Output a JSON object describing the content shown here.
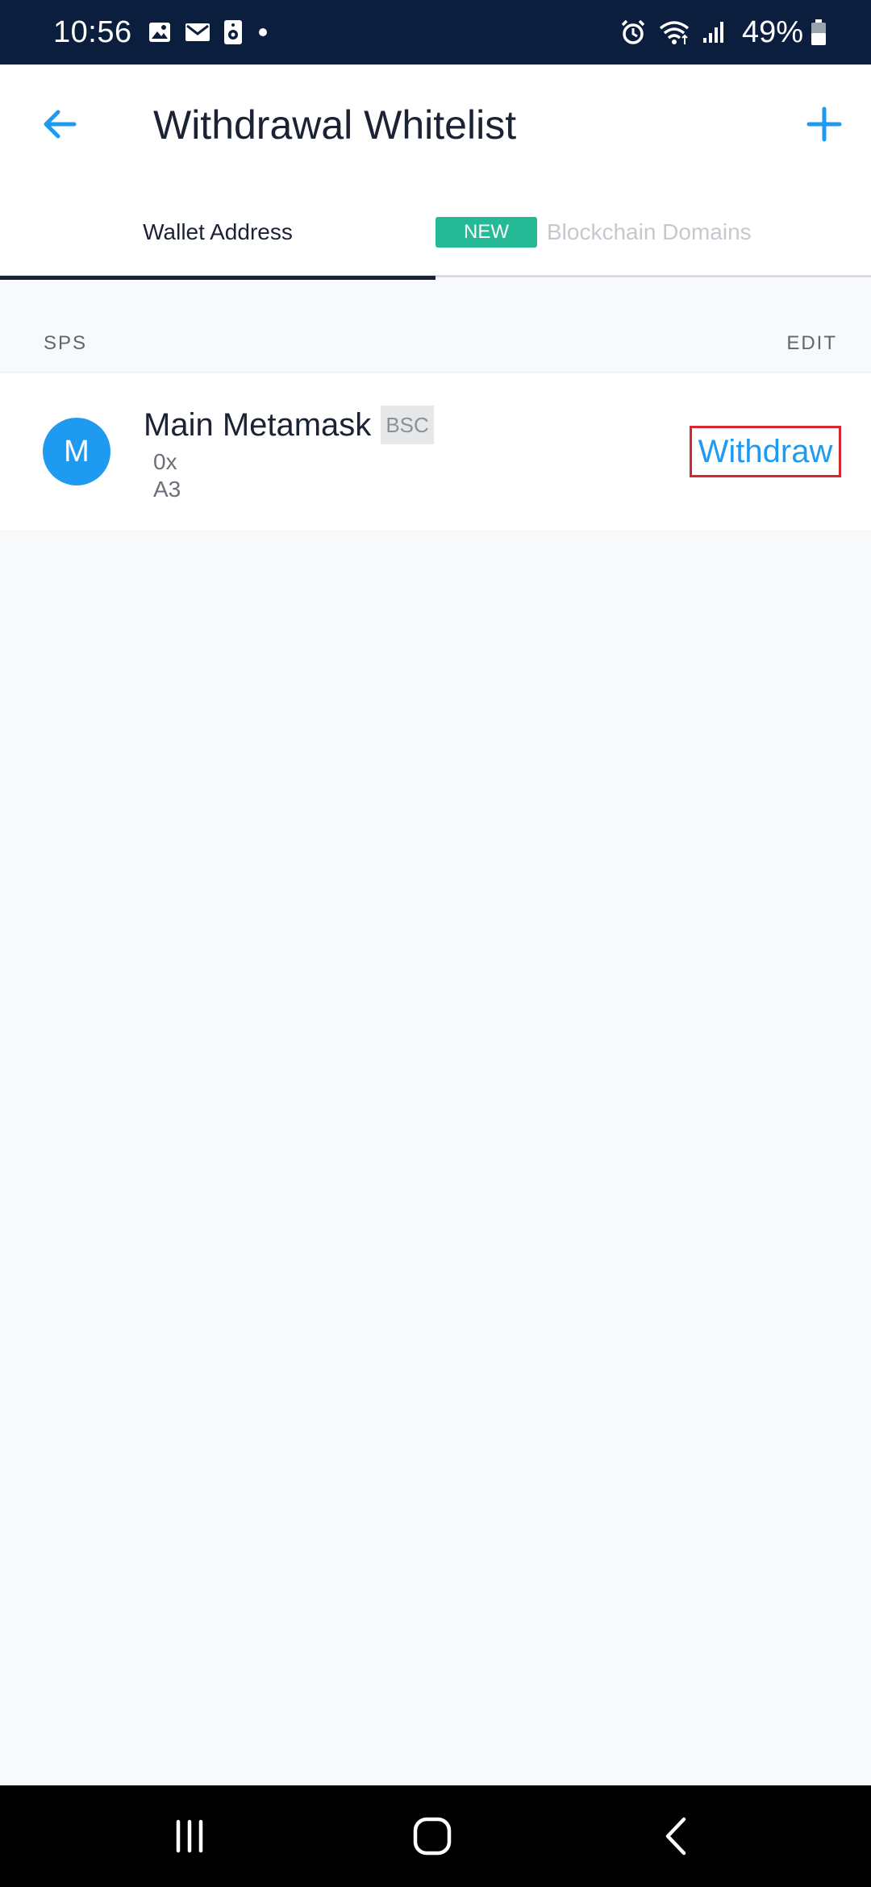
{
  "status_bar": {
    "time": "10:56",
    "battery": "49%",
    "left_icons": [
      "gallery-icon",
      "mail-icon",
      "speaker-icon",
      "dot-icon"
    ],
    "right_icons": [
      "alarm-icon",
      "wifi-icon",
      "signal-icon",
      "battery-icon"
    ]
  },
  "app_bar": {
    "title": "Withdrawal Whitelist",
    "back_icon": "arrow-left-icon",
    "add_icon": "plus-icon",
    "accent_color": "#1e9bf0"
  },
  "tabs": [
    {
      "label": "Wallet Address",
      "active": true
    },
    {
      "label": "Blockchain Domains",
      "active": false,
      "badge": "NEW"
    }
  ],
  "section": {
    "title": "SPS",
    "edit_label": "EDIT"
  },
  "address_item": {
    "avatar_letter": "M",
    "name": "Main Metamask",
    "network": "BSC",
    "address_line_1": "0x",
    "address_line_2": "A3",
    "withdraw_label": "Withdraw"
  },
  "nav_bar": {
    "icons": [
      "recent-apps-icon",
      "home-icon",
      "back-icon"
    ]
  },
  "colors": {
    "status_bar_bg": "#0c1e3e",
    "accent": "#1e9bf0",
    "new_badge": "#25b995",
    "highlight_border": "#d6262f"
  }
}
